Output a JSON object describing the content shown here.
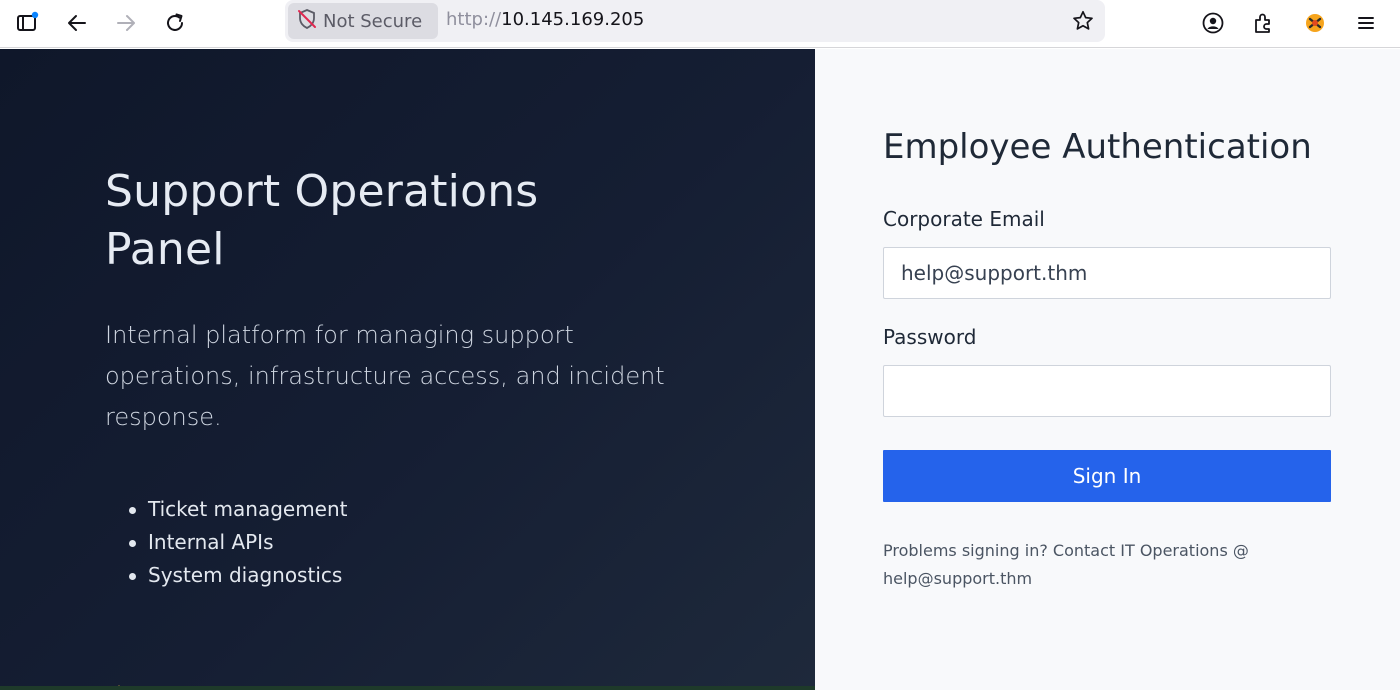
{
  "browser": {
    "security_label": "Not Secure",
    "url_scheme": "http://",
    "url_host": "10.145.169.205",
    "icons": [
      "sidebar-tabs-icon",
      "back-arrow-icon",
      "forward-arrow-icon",
      "reload-icon",
      "shield-slash-icon",
      "bookmark-star-icon",
      "account-icon",
      "extensions-icon",
      "extension-badge-icon",
      "menu-icon"
    ]
  },
  "hero": {
    "title": "Support Operations Panel",
    "description": "Internal platform for managing support operations, infrastructure access, and incident response.",
    "features": [
      "Ticket management",
      "Internal APIs",
      "System diagnostics"
    ]
  },
  "auth": {
    "title": "Employee Authentication",
    "email_label": "Corporate Email",
    "email_value": "help@support.thm",
    "password_label": "Password",
    "password_value": "",
    "signin_label": "Sign In",
    "help_text": "Problems signing in? Contact IT Operations @ help@support.thm"
  },
  "colors": {
    "hero_bg": "#0f172a",
    "auth_bg": "#f8f9fb",
    "button_bg": "#2563eb",
    "warning_text": "#d4b34a"
  }
}
